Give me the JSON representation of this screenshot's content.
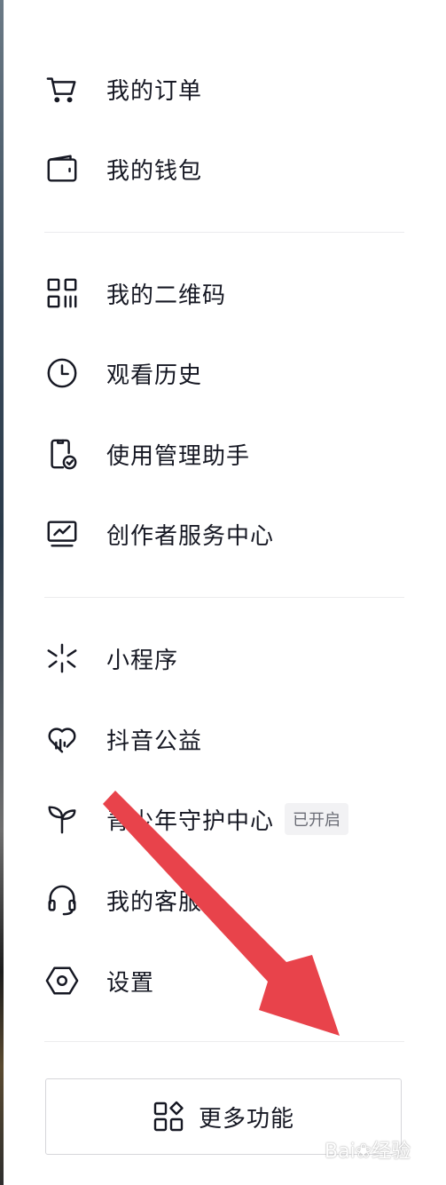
{
  "menu": {
    "group1": [
      {
        "label": "我的订单",
        "icon": "cart-icon"
      },
      {
        "label": "我的钱包",
        "icon": "wallet-icon"
      }
    ],
    "group2": [
      {
        "label": "我的二维码",
        "icon": "qr-code-icon"
      },
      {
        "label": "观看历史",
        "icon": "clock-icon"
      },
      {
        "label": "使用管理助手",
        "icon": "phone-check-icon"
      },
      {
        "label": "创作者服务中心",
        "icon": "monitor-chart-icon"
      }
    ],
    "group3": [
      {
        "label": "小程序",
        "icon": "mini-program-icon"
      },
      {
        "label": "抖音公益",
        "icon": "heart-charity-icon"
      },
      {
        "label": "青少年守护中心",
        "icon": "sprout-icon",
        "badge": "已开启"
      },
      {
        "label": "我的客服",
        "icon": "headset-icon"
      },
      {
        "label": "设置",
        "icon": "hexagon-settings-icon"
      }
    ]
  },
  "more_button": {
    "label": "更多功能",
    "icon": "grid-apps-icon"
  },
  "annotation": {
    "arrow_color": "#e8434b"
  },
  "watermark": {
    "text": "Bai❀经验"
  },
  "colors": {
    "text": "#161823",
    "divider": "#ececee",
    "badge_bg": "#f2f2f4",
    "badge_text": "#6b6d76"
  }
}
